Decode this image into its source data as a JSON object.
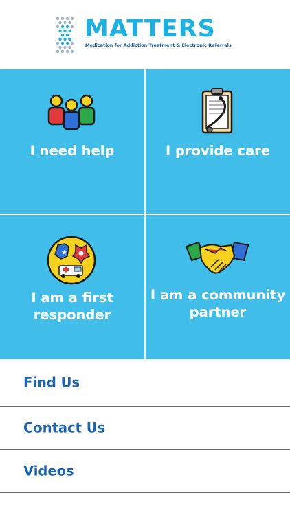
{
  "header": {
    "logo_title": "MATTERS",
    "logo_subtitle": "Medication for Addiction Treatment & Electronic Referrals"
  },
  "tiles": [
    {
      "label_lines": [
        "I need help"
      ],
      "icon": "people-group-icon"
    },
    {
      "label_lines": [
        "I provide care"
      ],
      "icon": "clipboard-stethoscope-icon"
    },
    {
      "label_lines": [
        "I am a first",
        "responder"
      ],
      "icon": "first-responder-badge-icon"
    },
    {
      "label_lines": [
        "I am a community",
        "partner"
      ],
      "icon": "handshake-icon"
    }
  ],
  "menu": [
    {
      "label": "Find Us"
    },
    {
      "label": "Contact Us"
    },
    {
      "label": "Videos"
    }
  ],
  "colors": {
    "tile_background": "#41bde9",
    "logo_cyan": "#1bb0e2",
    "menu_text": "#1a62b3"
  }
}
